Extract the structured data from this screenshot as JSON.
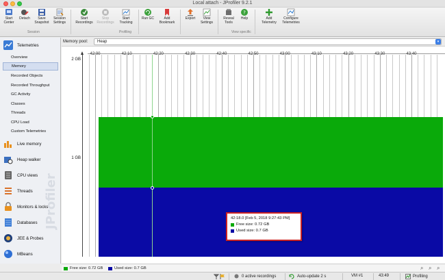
{
  "window": {
    "title": "Local attach - JProfiler 9.2.1"
  },
  "toolbar": {
    "buttons": [
      {
        "label": "Start\nCenter",
        "icon": "start-center-icon",
        "disabled": false
      },
      {
        "label": "Detach",
        "icon": "detach-icon",
        "disabled": false
      },
      {
        "label": "Save\nSnapshot",
        "icon": "save-icon",
        "disabled": false
      },
      {
        "label": "Session\nSettings",
        "icon": "session-settings-icon",
        "disabled": false
      },
      {
        "label": "Start\nRecordings",
        "icon": "start-recordings-icon",
        "disabled": false
      },
      {
        "label": "Stop\nRecordings",
        "icon": "stop-recordings-icon",
        "disabled": true
      },
      {
        "label": "Start\nTracking",
        "icon": "start-tracking-icon",
        "disabled": false
      },
      {
        "label": "Run GC",
        "icon": "run-gc-icon",
        "disabled": false
      },
      {
        "label": "Add\nBookmark",
        "icon": "bookmark-icon",
        "disabled": false
      },
      {
        "label": "Export",
        "icon": "export-icon",
        "disabled": false
      },
      {
        "label": "View\nSettings",
        "icon": "view-settings-icon",
        "disabled": false
      },
      {
        "label": "Reveal\nTools",
        "icon": "reveal-tools-icon",
        "disabled": false
      },
      {
        "label": "Help",
        "icon": "help-icon",
        "disabled": false
      },
      {
        "label": "Add\nTelemetry",
        "icon": "add-telemetry-icon",
        "disabled": false
      },
      {
        "label": "Configure\nTelemetries",
        "icon": "configure-telemetries-icon",
        "disabled": false
      }
    ],
    "groups": {
      "session": "Session",
      "profiling": "Profiling",
      "view_specific": "View specific"
    }
  },
  "sidebar": {
    "telemetries_label": "Telemetries",
    "sub_items": [
      "Overview",
      "Memory",
      "Recorded Objects",
      "Recorded Throughput",
      "GC Activity",
      "Classes",
      "Threads",
      "CPU Load",
      "Custom Telemetries"
    ],
    "selected_sub": "Memory",
    "sections": [
      {
        "label": "Live memory",
        "icon": "live-memory-icon"
      },
      {
        "label": "Heap walker",
        "icon": "heap-walker-icon"
      },
      {
        "label": "CPU views",
        "icon": "cpu-views-icon"
      },
      {
        "label": "Threads",
        "icon": "threads-icon"
      },
      {
        "label": "Monitors & locks",
        "icon": "monitors-locks-icon"
      },
      {
        "label": "Databases",
        "icon": "databases-icon"
      },
      {
        "label": "JEE & Probes",
        "icon": "jee-probes-icon"
      },
      {
        "label": "MBeans",
        "icon": "mbeans-icon"
      }
    ],
    "watermark": "JProfiler"
  },
  "memory_pool": {
    "label": "Memory pool:",
    "value": "Heap"
  },
  "chart_data": {
    "type": "area",
    "x_tick_labels": [
      "42:00",
      "42:10",
      "42:20",
      "42:30",
      "42:40",
      "42:50",
      "43:00",
      "43:10",
      "43:20",
      "43:30",
      "43:40"
    ],
    "y_tick_labels": [
      "2 GB",
      "1 GB"
    ],
    "ylim_gb": [
      0,
      2.05
    ],
    "series": [
      {
        "name": "Free size",
        "color": "#0aaa0a",
        "value_gb": 0.72
      },
      {
        "name": "Used size",
        "color": "#0a0aa5",
        "value_gb": 0.7
      }
    ],
    "data_start": "42:01"
  },
  "tooltip": {
    "timestamp": "42:18.0 [Feb 5, 2018 9:27:43 PM]",
    "free": "Free size:  0.72 GB",
    "used": "Used size:  0.7 GB"
  },
  "legend": {
    "free": "Free size: 0.72 GB",
    "used": "Used size: 0.7 GB"
  },
  "status": {
    "recordings": "0 active recordings",
    "autoupdate": "Auto-update 2 s",
    "vm": "VM #1",
    "time": "43:49",
    "mode": "Profiling"
  }
}
